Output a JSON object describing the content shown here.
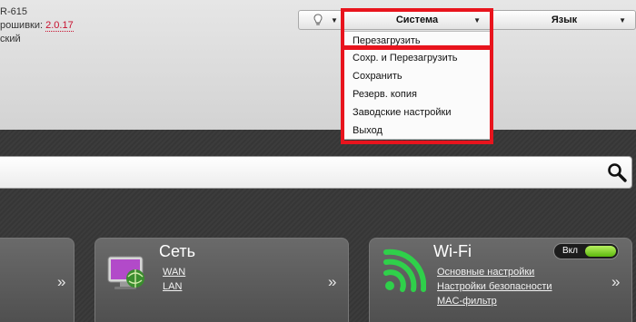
{
  "device": {
    "model": "R-615",
    "firmware_label": "рошивки:",
    "firmware_version": "2.0.17",
    "language_fragment": "ский"
  },
  "topbar": {
    "hint_icon": "lightbulb-icon",
    "system_label": "Система",
    "language_label": "Язык"
  },
  "system_menu": {
    "items": [
      "Перезагрузить",
      "Сохр. и Перезагрузить",
      "Сохранить",
      "Резерв. копия",
      "Заводские настройки",
      "Выход"
    ]
  },
  "search": {
    "placeholder": "",
    "icon": "search-icon"
  },
  "cards": {
    "left_chevron": "»",
    "network": {
      "title": "Сеть",
      "links": [
        "WAN",
        "LAN"
      ],
      "chevron": "»",
      "icon": "network-icon"
    },
    "wifi": {
      "title": "Wi-Fi",
      "toggle_label": "Вкл",
      "links": [
        "Основные настройки",
        "Настройки безопасности",
        "MAC-фильтр"
      ],
      "chevron": "»",
      "icon": "wifi-icon"
    }
  },
  "colors": {
    "highlight": "#e8141d",
    "firmware_version": "#c8102e",
    "toggle_on": "#5cb80d"
  }
}
